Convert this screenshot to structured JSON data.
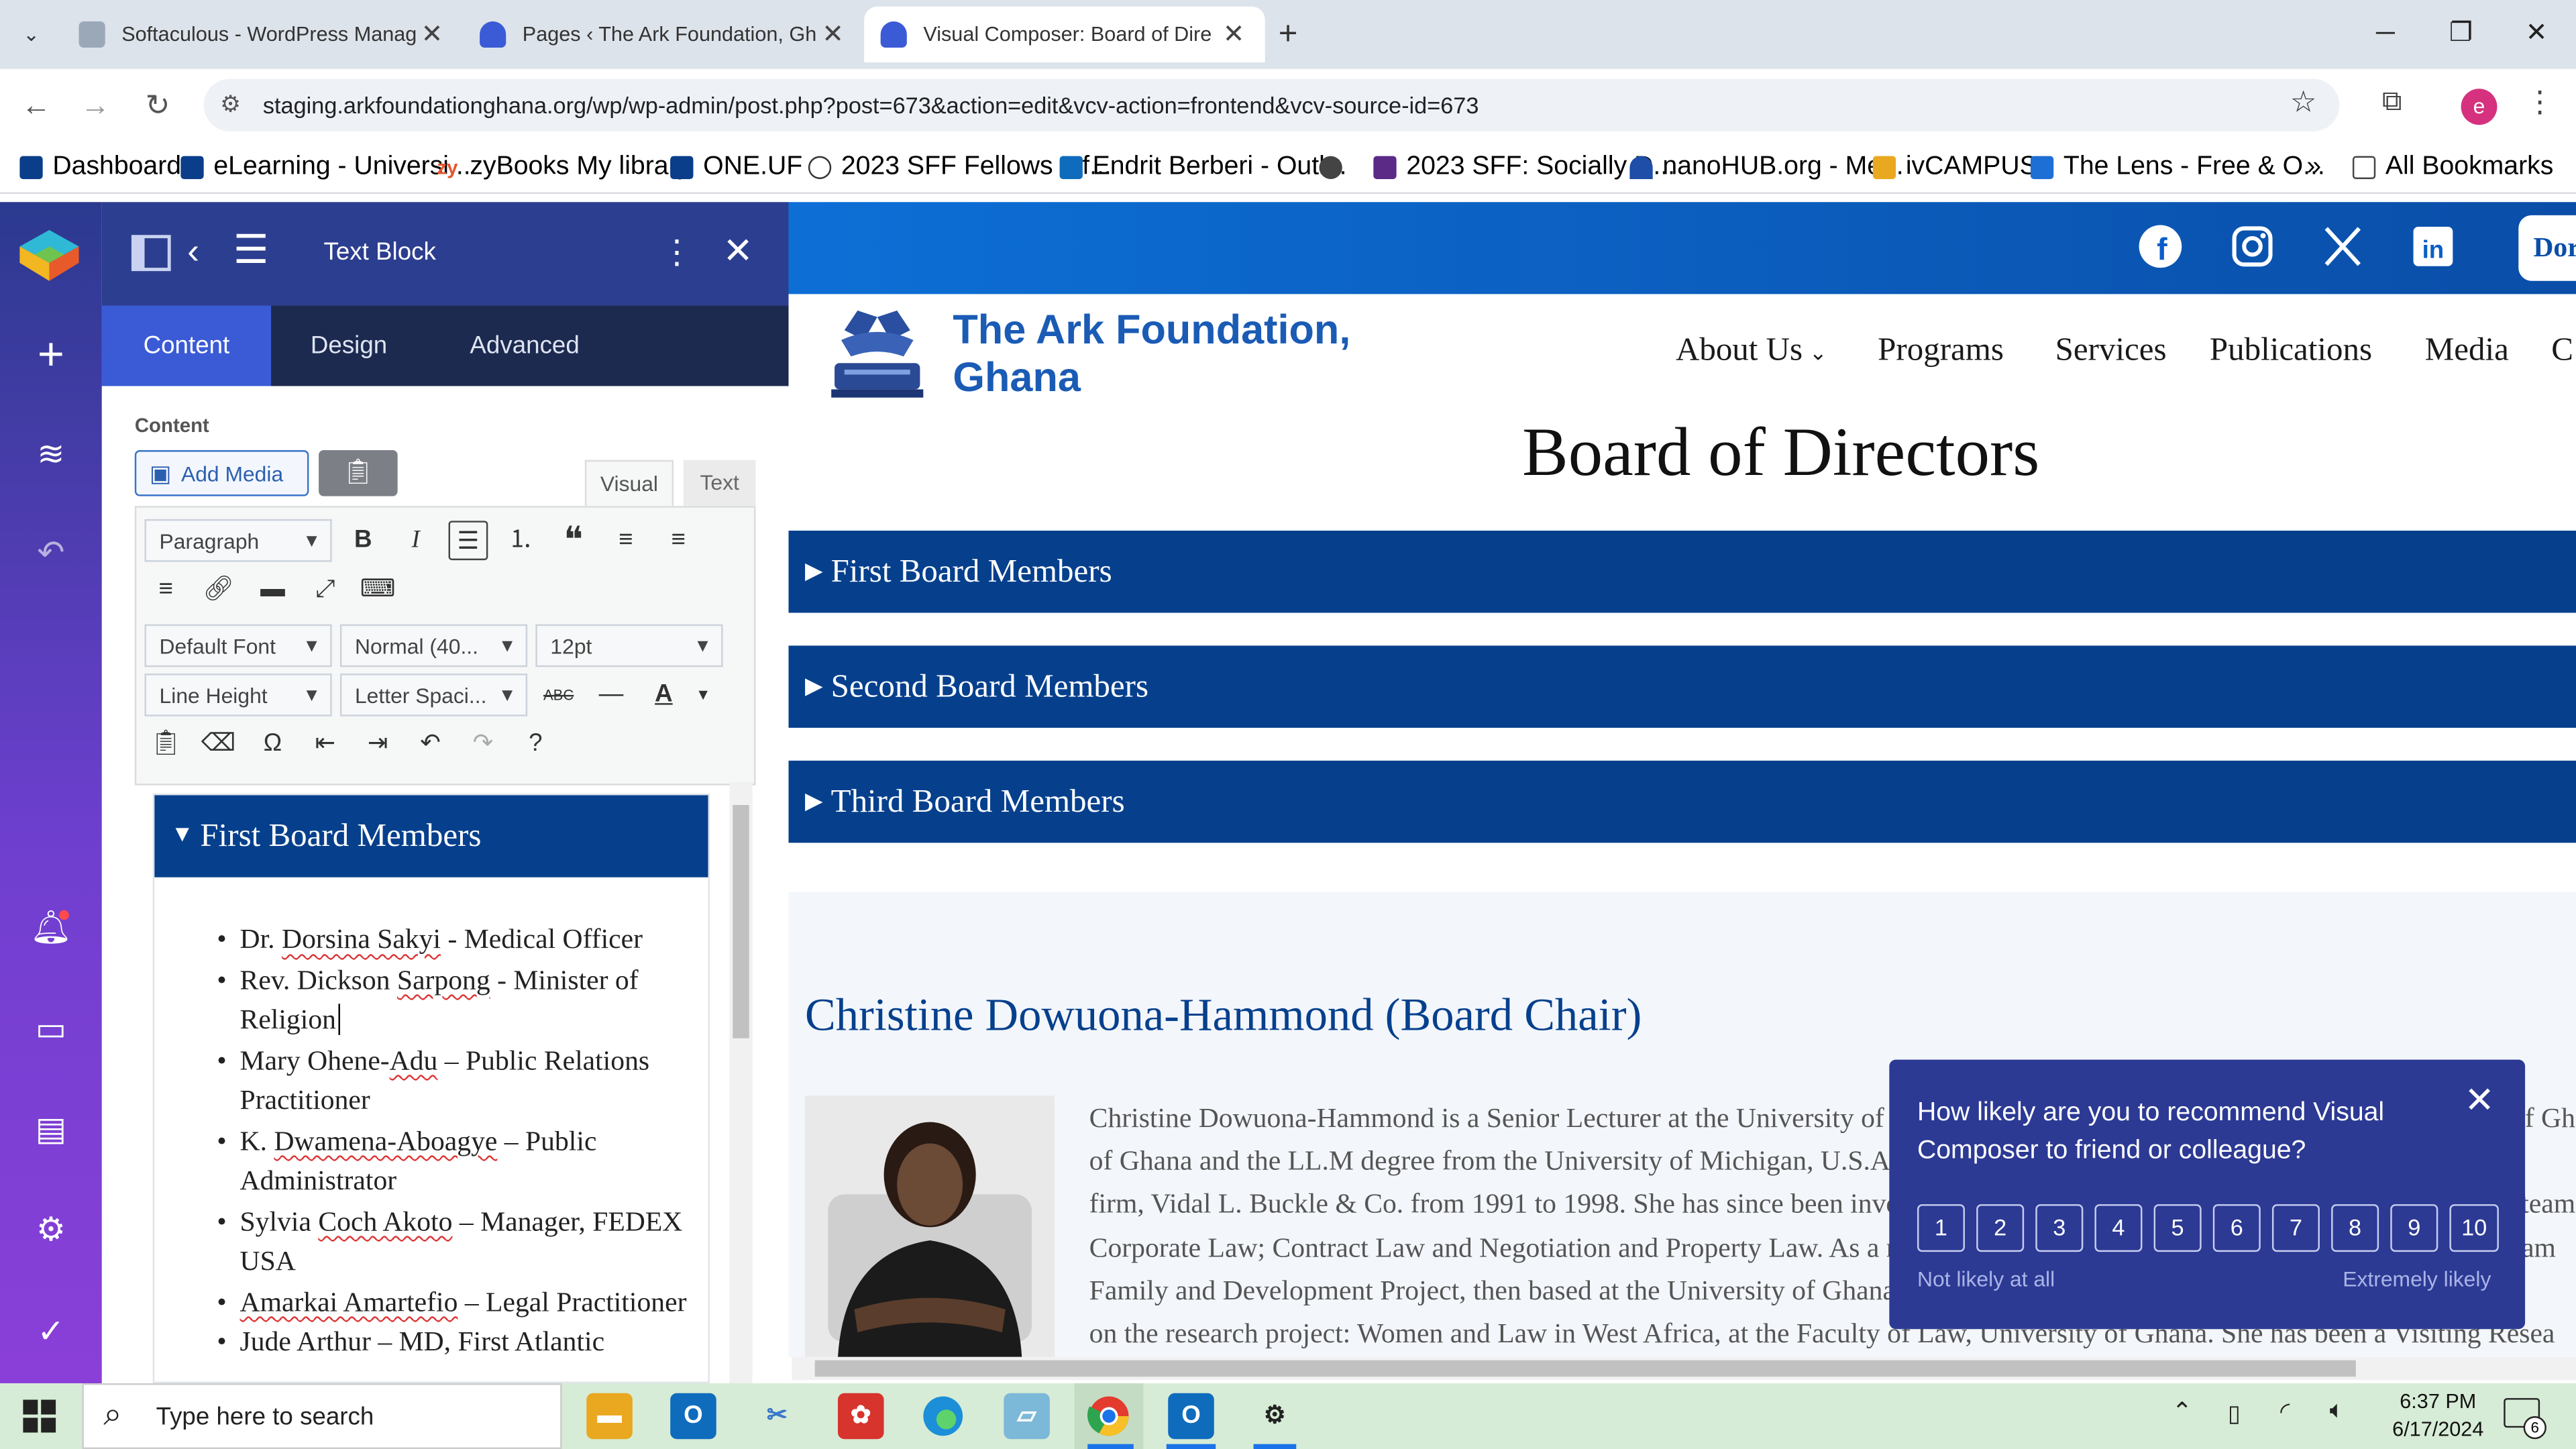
{
  "browser": {
    "tabs": [
      {
        "title": "Softaculous - WordPress Manag"
      },
      {
        "title": "Pages ‹ The Ark Foundation, Gh"
      },
      {
        "title": "Visual Composer: Board of Dire"
      }
    ],
    "url": "staging.arkfoundationghana.org/wp/wp-admin/post.php?post=673&action=edit&vcv-action=frontend&vcv-source-id=673",
    "profile_initial": "e",
    "bookmarks": [
      "Dashboard",
      "eLearning - Universi...",
      "zyBooks My library",
      "ONE.UF",
      "2023 SFF Fellows Inf...",
      "Endrit Berberi - Outl...",
      "2023 SFF: Socially D...",
      "nanoHUB.org - Me...",
      "ivCAMPUS",
      "The Lens - Free & O..."
    ],
    "all_bookmarks": "All Bookmarks",
    "more": "»"
  },
  "panel": {
    "title": "Text Block",
    "tabs": [
      "Content",
      "Design",
      "Advanced"
    ],
    "content_label": "Content",
    "add_media": "Add Media",
    "mode_visual": "Visual",
    "mode_text": "Text",
    "format_select": "Paragraph",
    "font_select": "Default Font",
    "weight_select": "Normal (40...",
    "size_select": "12pt",
    "line_height_select": "Line Height",
    "letter_spacing_select": "Letter Spaci...",
    "editor": {
      "heading": "First Board Members",
      "items": [
        {
          "pre": "Dr. ",
          "sq": "Dorsina Sakyi",
          "post": " - Medical Officer"
        },
        {
          "pre": "Rev. Dickson ",
          "sq": "Sarpong",
          "post": " - Minister of Religion"
        },
        {
          "pre": "Mary Ohene-",
          "sq": "Adu",
          "post": " – Public Relations Practitioner"
        },
        {
          "pre": "K. ",
          "sq": "Dwamena-Aboagye",
          "post": " – Public Administrator"
        },
        {
          "pre": "Sylvia ",
          "sq": "Coch Akoto",
          "post": " – Manager, FEDEX USA"
        },
        {
          "pre": "",
          "sq": "Amarkai Amartefio",
          "post": " – Legal Practitioner"
        },
        {
          "pre": "Jude Arthur – MD, First Atlantic",
          "sq": "",
          "post": ""
        }
      ]
    }
  },
  "site": {
    "org_name_line1": "The Ark Foundation,",
    "org_name_line2": "Ghana",
    "donate": "Dor",
    "menu": [
      "About Us",
      "Programs",
      "Services",
      "Publications",
      "Media",
      "C"
    ],
    "page_title": "Board of Directors",
    "accordions": [
      "First Board Members",
      "Second Board Members",
      "Third Board Members"
    ],
    "chair_heading": "Christine Dowuona-Hammond (Board Chair)",
    "bio_lines": [
      "Christine Dowuona-Hammond is a Senior Lecturer at the University of Ghana. She holds the LL.B degree from the University of Ghana and the",
      "of Ghana and the LL.M degree from the University of Michigan, U.S.A. She worked with the law firm and later with the cor",
      "firm, Vidal L. Buckle & Co. from 1991 to 1998. She has since been involved in research on gender and development issues and team developm",
      "Corporate Law; Contract Law and Negotiation and Property Law. As a researcher she worked on the Women and Law Project team",
      "Family and Development Project, then based at the University of Ghana Faculty of Law. She was also a researcher, wh",
      "on the research project: Women and Law in West Africa, at the Faculty of Law, University of Ghana. She has been a Visiting Resea"
    ]
  },
  "survey": {
    "question": "How likely are you to recommend Visual Composer to friend or colleague?",
    "scores": [
      "1",
      "2",
      "3",
      "4",
      "5",
      "6",
      "7",
      "8",
      "9",
      "10"
    ],
    "low_label": "Not likely at all",
    "high_label": "Extremely likely"
  },
  "taskbar": {
    "search_placeholder": "Type here to search",
    "time": "6:37 PM",
    "date": "6/17/2024",
    "notif_count": "6"
  },
  "colors": {
    "accent": "#06408d",
    "vc_header": "#2c3e8f",
    "survey": "#2c3a94",
    "site_top": "#0d6fd6",
    "taskbar": "#d7ecd6"
  }
}
